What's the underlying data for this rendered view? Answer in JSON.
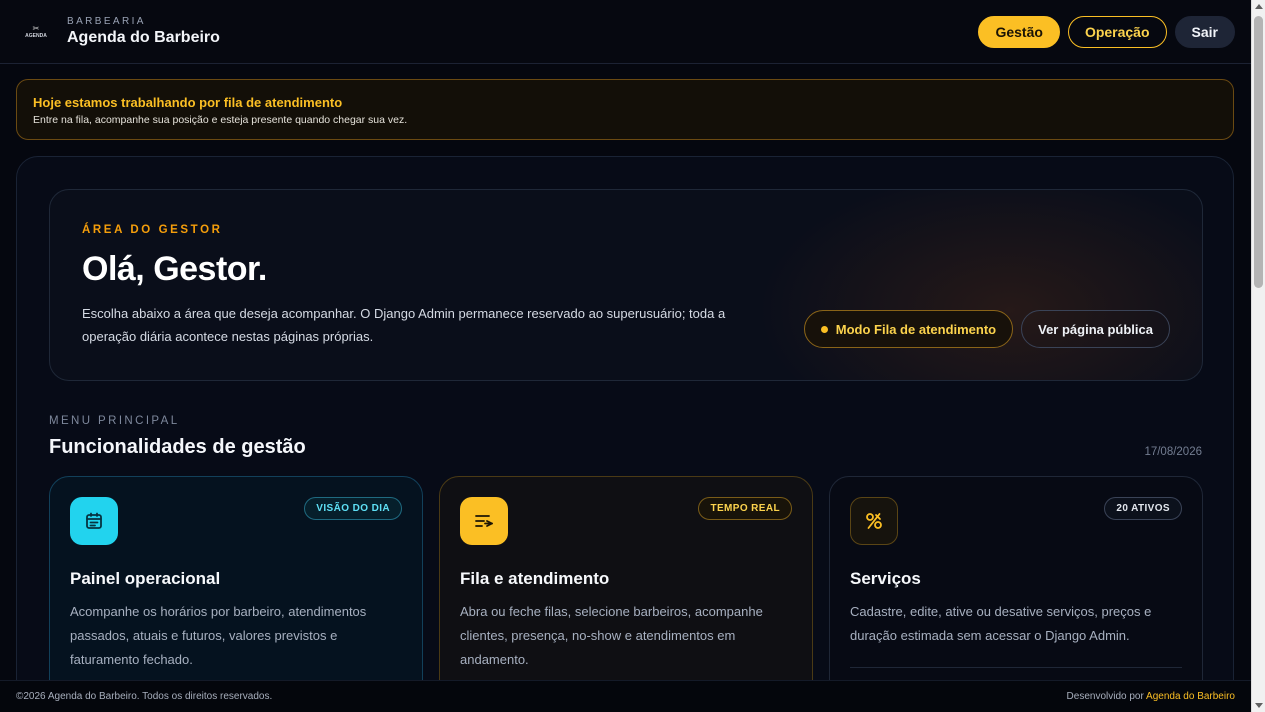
{
  "header": {
    "logo_text": "AGENDA",
    "kicker": "BARBEARIA",
    "title": "Agenda do Barbeiro",
    "nav": [
      {
        "label": "Gestão"
      },
      {
        "label": "Operação"
      },
      {
        "label": "Sair"
      }
    ]
  },
  "alert": {
    "title": "Hoje estamos trabalhando por fila de atendimento",
    "description": "Entre na fila, acompanhe sua posição e esteja presente quando chegar sua vez."
  },
  "hero": {
    "kicker": "ÁREA DO GESTOR",
    "greeting": "Olá, Gestor.",
    "description": "Escolha abaixo a área que deseja acompanhar. O Django Admin permanece reservado ao superusuário; toda a operação diária acontece nestas páginas próprias.",
    "mode_button": "Modo Fila de atendimento",
    "public_button": "Ver página pública"
  },
  "menu": {
    "kicker": "MENU PRINCIPAL",
    "title": "Funcionalidades de gestão",
    "date": "17/08/2026"
  },
  "cards": [
    {
      "icon": "calendar-icon",
      "badge": "VISÃO DO DIA",
      "title": "Painel operacional",
      "description": "Acompanhe os horários por barbeiro, atendimentos passados, atuais e futuros, valores previstos e faturamento fechado."
    },
    {
      "icon": "queue-icon",
      "badge": "TEMPO REAL",
      "title": "Fila e atendimento",
      "description": "Abra ou feche filas, selecione barbeiros, acompanhe clientes, presença, no-show e atendimentos em andamento."
    },
    {
      "icon": "tools-icon",
      "badge": "20 ATIVOS",
      "title": "Serviços",
      "description": "Cadastre, edite, ative ou desative serviços, preços e duração estimada sem acessar o Django Admin."
    }
  ],
  "footer": {
    "copyright": "©2026 Agenda do Barbeiro. Todos os direitos reservados.",
    "credit_prefix": "Desenvolvido por",
    "credit_link": "Agenda do Barbeiro"
  },
  "colors": {
    "accent": "#fbbf24",
    "cyan": "#22d3ee",
    "background": "#05070f"
  }
}
